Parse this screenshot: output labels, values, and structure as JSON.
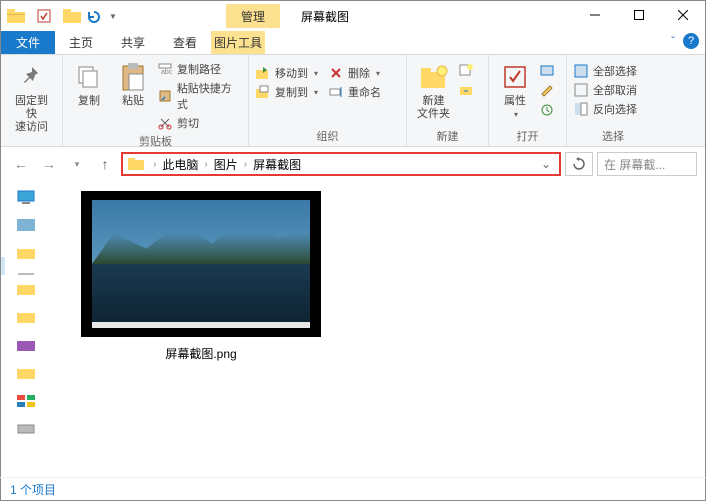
{
  "titlebar": {
    "manage_tab": "管理",
    "window_title": "屏幕截图"
  },
  "tabs": {
    "file": "文件",
    "home": "主页",
    "share": "共享",
    "view": "查看",
    "pic_tools": "图片工具"
  },
  "ribbon": {
    "pin": "固定到快\n速访问",
    "copy": "复制",
    "paste": "粘贴",
    "cut": "剪切",
    "copy_path": "复制路径",
    "paste_shortcut": "粘贴快捷方式",
    "group1": "剪贴板",
    "move_to": "移动到",
    "copy_to": "复制到",
    "delete": "删除",
    "rename": "重命名",
    "group2": "组织",
    "new_folder": "新建\n文件夹",
    "group3": "新建",
    "properties": "属性",
    "group4": "打开",
    "select_all": "全部选择",
    "select_none": "全部取消",
    "invert": "反向选择",
    "group5": "选择"
  },
  "breadcrumb": {
    "root": "此电脑",
    "pictures": "图片",
    "folder": "屏幕截图"
  },
  "search": {
    "placeholder": "在 屏幕截..."
  },
  "file_item": {
    "name": "屏幕截图.png"
  },
  "status": {
    "count": "1 个项目"
  }
}
